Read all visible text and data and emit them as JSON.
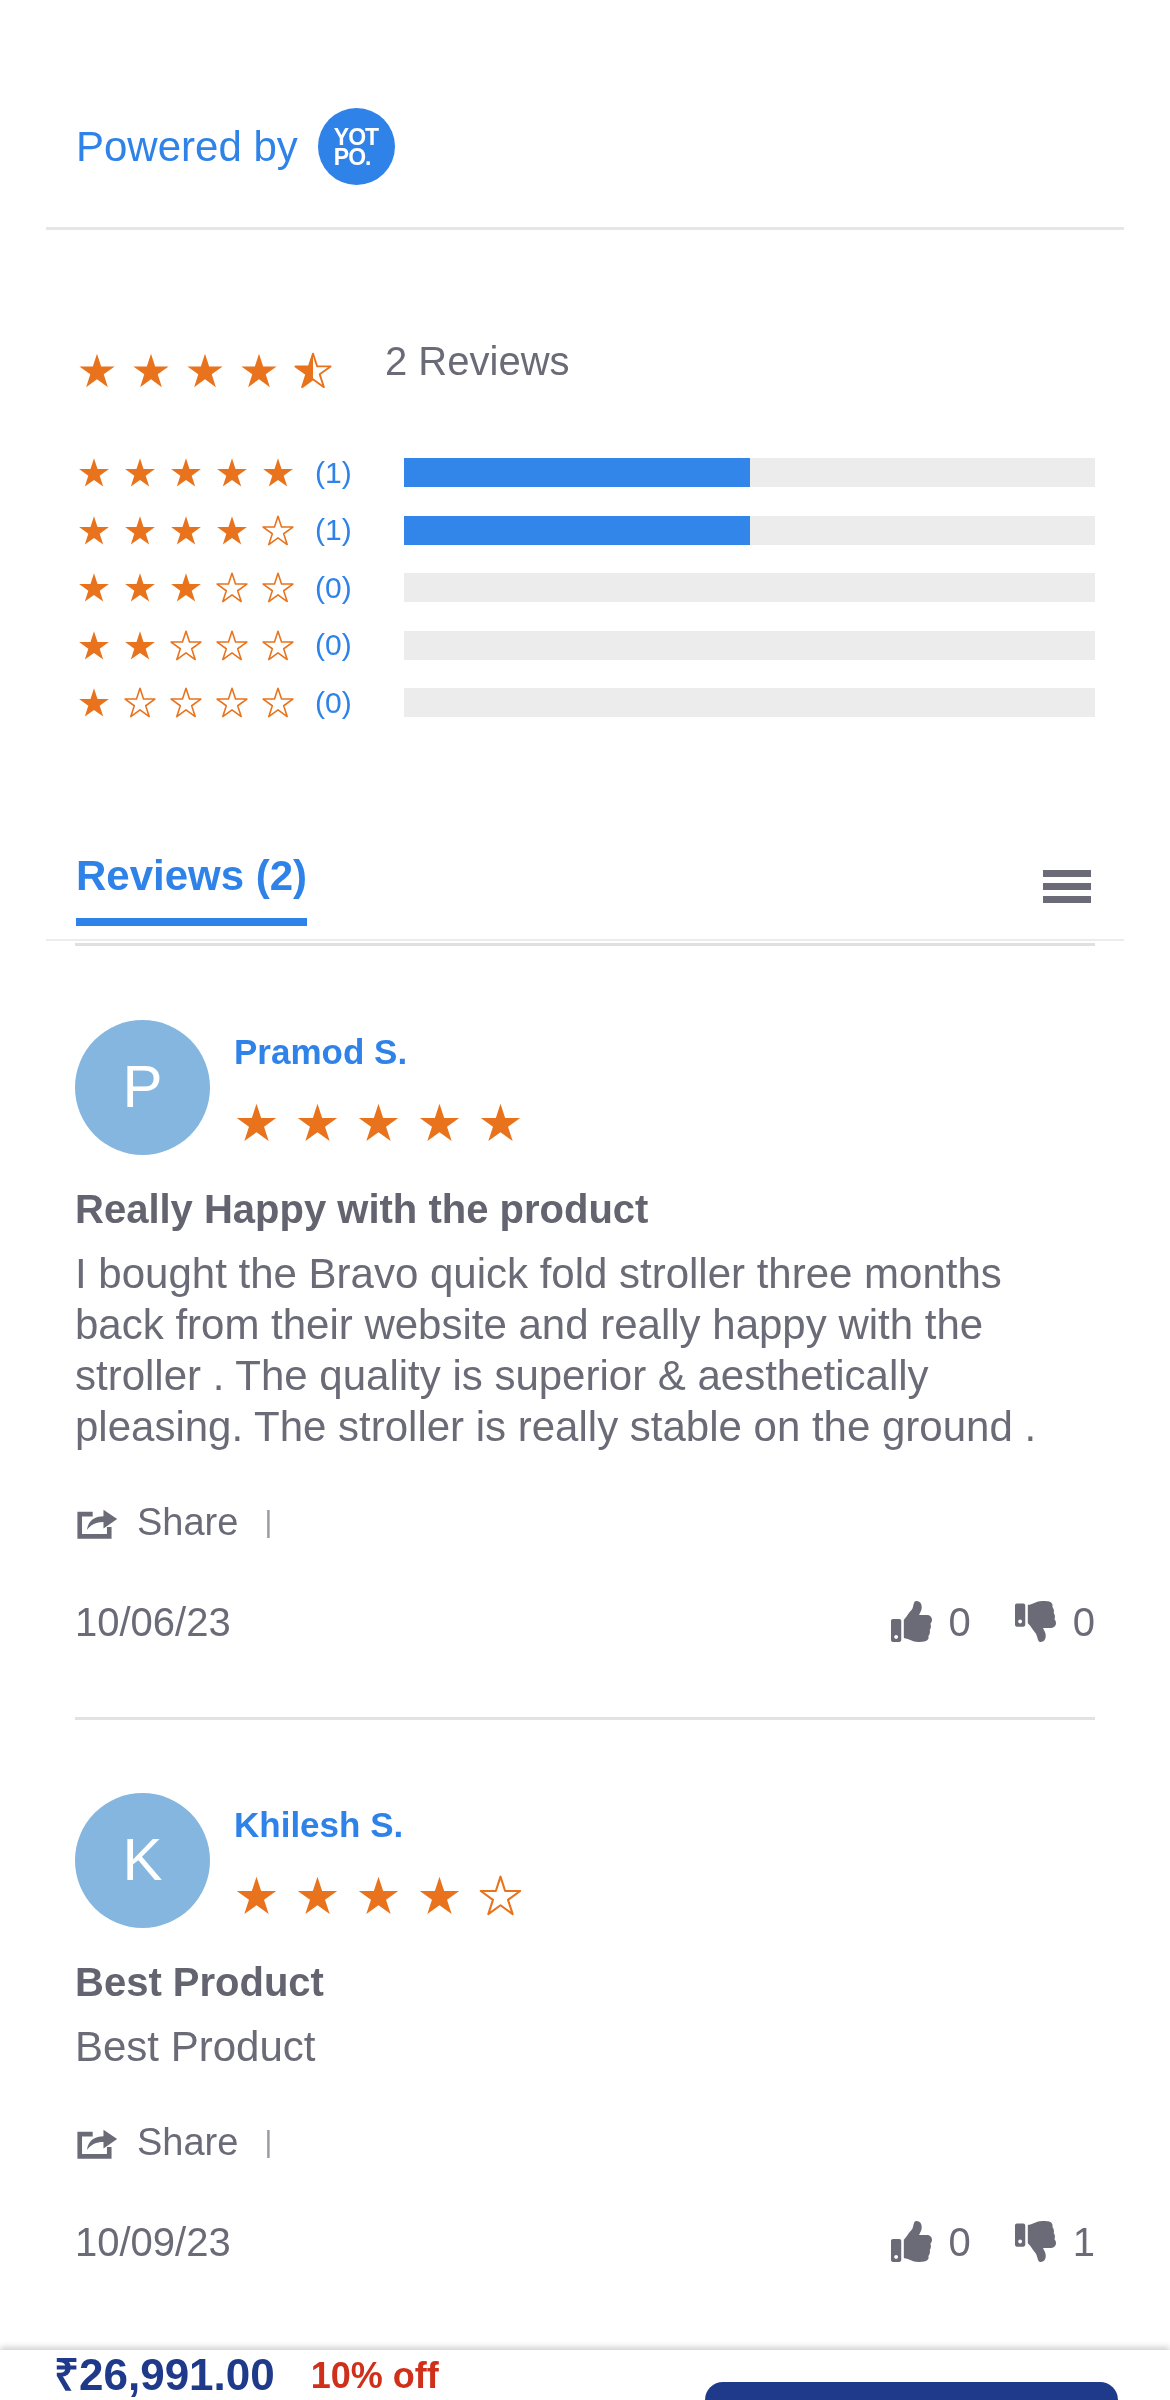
{
  "powered_by": {
    "label": "Powered by",
    "logo_lines": [
      "YOT",
      "PO."
    ]
  },
  "summary": {
    "stars": 4.5,
    "label": "2 Reviews"
  },
  "breakdown": [
    {
      "stars": 5,
      "count": "(1)",
      "level": 0.5
    },
    {
      "stars": 4,
      "count": "(1)",
      "level": 0.5
    },
    {
      "stars": 3,
      "count": "(0)",
      "level": 0
    },
    {
      "stars": 2,
      "count": "(0)",
      "level": 0
    },
    {
      "stars": 1,
      "count": "(0)",
      "level": 0
    }
  ],
  "tabs": [
    {
      "label": "Reviews (2)",
      "selected": true
    }
  ],
  "reviews": [
    {
      "initial": "P",
      "name": "Pramod S.",
      "stars": 5,
      "title": "Really Happy with the product",
      "body": "I bought the Bravo quick fold stroller three months back from their website and really happy with the stroller . The quality is superior & aesthetically pleasing. The stroller is really stable on the ground .",
      "share": "Share",
      "separator": "|",
      "date": "10/06/23",
      "likes": "0",
      "dislikes": "0"
    },
    {
      "initial": "K",
      "name": "Khilesh S.",
      "stars": 4,
      "title": "Best Product",
      "body": "Best Product",
      "share": "Share",
      "separator": "|",
      "date": "10/09/23",
      "likes": "0",
      "dislikes": "1"
    }
  ],
  "bottom_bar": {
    "price": "₹26,991.00",
    "discount": "10% off"
  }
}
